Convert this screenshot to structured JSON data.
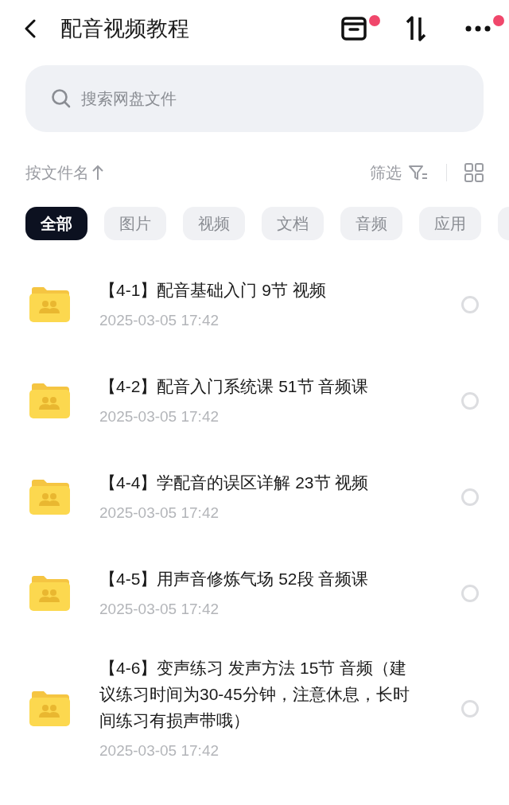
{
  "header": {
    "title": "配音视频教程",
    "actions": [
      {
        "kind": "archive",
        "badge": true
      },
      {
        "kind": "sort",
        "badge": false
      },
      {
        "kind": "more",
        "badge": true
      }
    ]
  },
  "search": {
    "placeholder": "搜索网盘文件"
  },
  "sort_bar": {
    "sort_label": "按文件名",
    "filter_label": "筛选"
  },
  "chips": [
    {
      "label": "全部",
      "selected": true
    },
    {
      "label": "图片",
      "selected": false
    },
    {
      "label": "视频",
      "selected": false
    },
    {
      "label": "文档",
      "selected": false
    },
    {
      "label": "音频",
      "selected": false
    },
    {
      "label": "应用",
      "selected": false
    }
  ],
  "files": [
    {
      "name": "【4-1】配音基础入门 9节 视频",
      "date": "2025-03-05  17:42",
      "selected": false
    },
    {
      "name": "【4-2】配音入门系统课  51节 音频课",
      "date": "2025-03-05  17:42",
      "selected": false
    },
    {
      "name": "【4-4】学配音的误区详解 23节 视频",
      "date": "2025-03-05  17:42",
      "selected": false
    },
    {
      "name": "【4-5】用声音修炼气场 52段 音频课",
      "date": "2025-03-05  17:42",
      "selected": false
    },
    {
      "name": "【4-6】变声练习 发声方法 15节 音频（建议练习时间为30-45分钟，注意休息，长时间练习有损声带哦）",
      "date": "2025-03-05  17:42",
      "selected": false
    }
  ]
}
